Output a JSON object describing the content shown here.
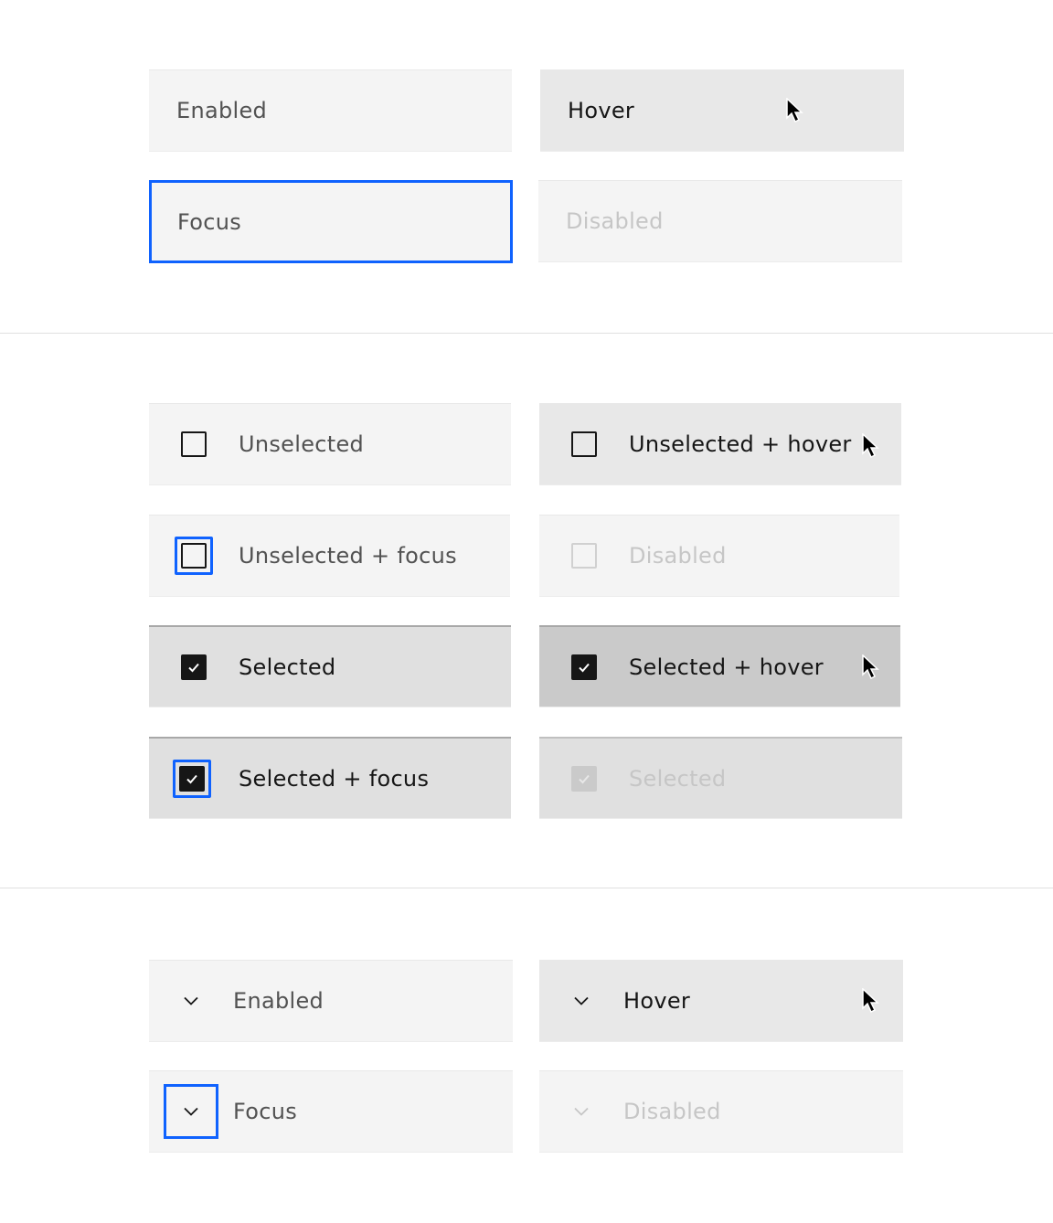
{
  "colors": {
    "focus": "#0f62fe",
    "tile_bg": "#f4f4f4",
    "tile_hover_bg": "#e8e8e8",
    "tile_selected_bg": "#e0e0e0",
    "tile_selected_hover_bg": "#cacaca",
    "text_primary": "#161616",
    "text_secondary": "#525252",
    "text_disabled": "#c6c6c6"
  },
  "sections": {
    "clickable": {
      "tiles": [
        {
          "label": "Enabled",
          "state": "enabled"
        },
        {
          "label": "Hover",
          "state": "hover"
        },
        {
          "label": "Focus",
          "state": "focus"
        },
        {
          "label": "Disabled",
          "state": "disabled"
        }
      ]
    },
    "selectable": {
      "tiles": [
        {
          "label": "Unselected",
          "state": "unselected",
          "checked": false
        },
        {
          "label": "Unselected + hover",
          "state": "unselected-hover",
          "checked": false
        },
        {
          "label": "Unselected + focus",
          "state": "unselected-focus",
          "checked": false
        },
        {
          "label": "Disabled",
          "state": "unselected-disabled",
          "checked": false
        },
        {
          "label": "Selected",
          "state": "selected",
          "checked": true
        },
        {
          "label": "Selected + hover",
          "state": "selected-hover",
          "checked": true
        },
        {
          "label": "Selected + focus",
          "state": "selected-focus",
          "checked": true
        },
        {
          "label": "Selected",
          "state": "selected-disabled",
          "checked": true
        }
      ]
    },
    "expandable": {
      "tiles": [
        {
          "label": "Enabled",
          "state": "enabled",
          "icon": "chevron-down-icon"
        },
        {
          "label": "Hover",
          "state": "hover",
          "icon": "chevron-down-icon"
        },
        {
          "label": "Focus",
          "state": "focus",
          "icon": "chevron-down-icon"
        },
        {
          "label": "Disabled",
          "state": "disabled",
          "icon": "chevron-down-icon"
        }
      ]
    }
  }
}
